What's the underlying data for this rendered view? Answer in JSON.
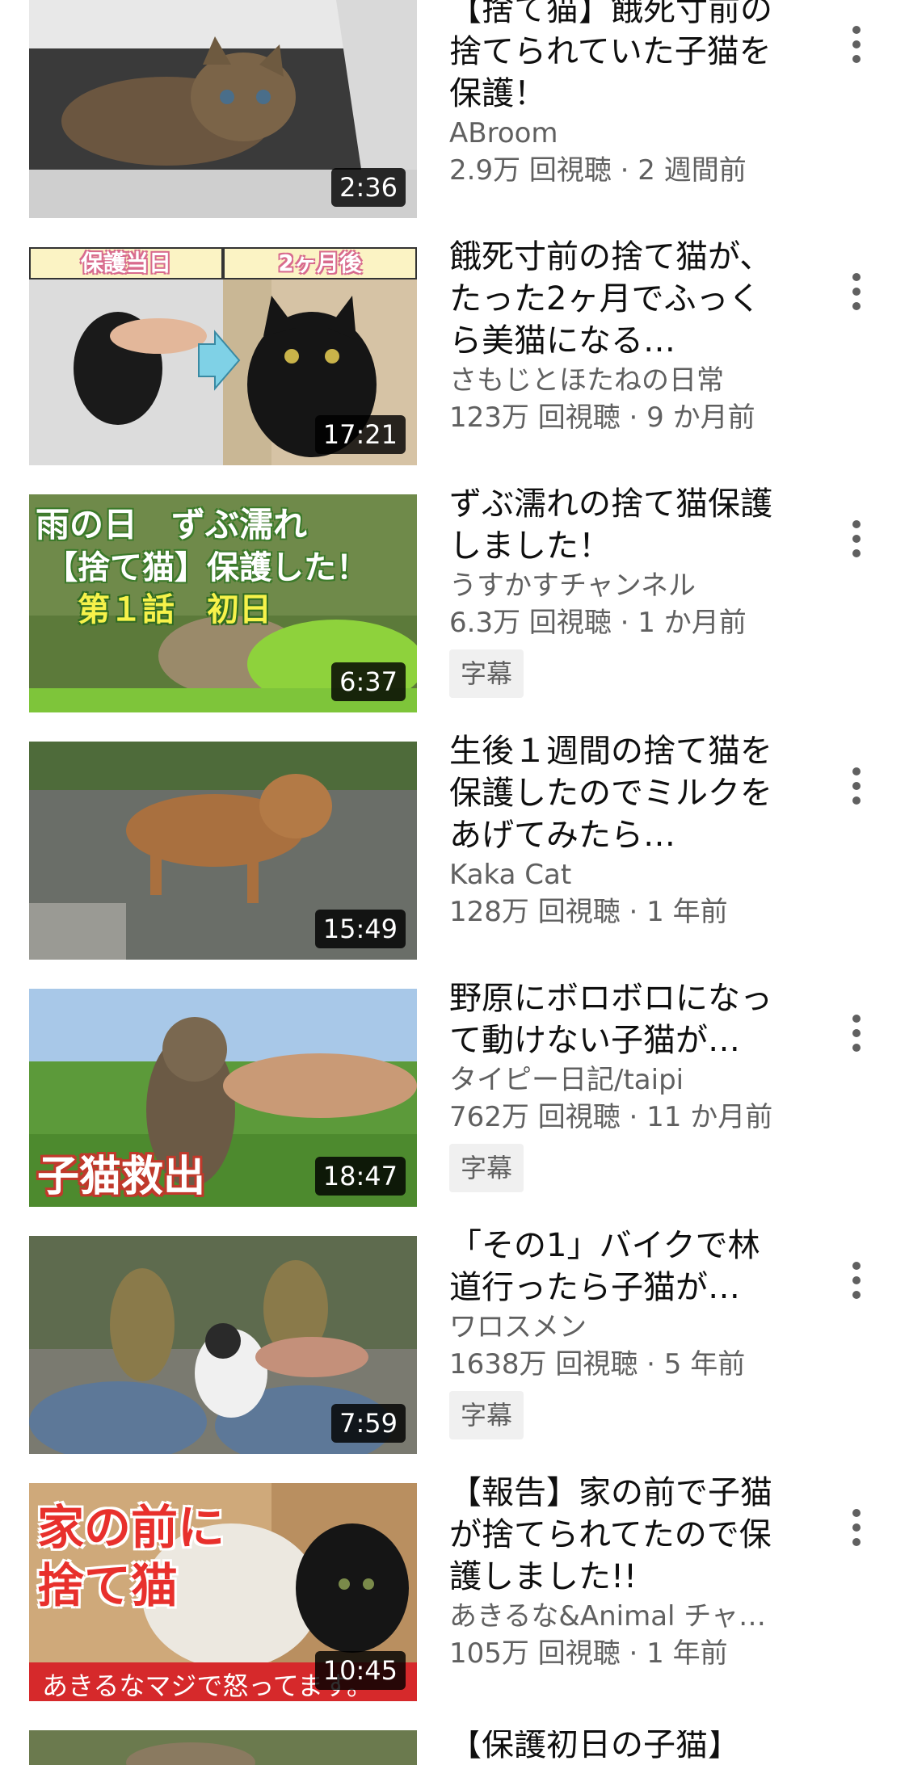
{
  "videos": [
    {
      "title": "【捨て猫】餓死寸前の捨てられていた子猫を保護！",
      "channel": "ABroom",
      "meta": "2.9万 回視聴 · 2 週間前",
      "duration": "2:36",
      "badge": ""
    },
    {
      "title": "餓死寸前の捨て猫が、たった2ヶ月でふっくら美猫になる…",
      "channel": "さもじとほたねの日常",
      "meta": "123万 回視聴 · 9 か月前",
      "duration": "17:21",
      "badge": "",
      "thumb_text": [
        "保護当日",
        "2ヶ月後"
      ]
    },
    {
      "title": "ずぶ濡れの捨て猫保護しました！",
      "channel": "うすかすチャンネル",
      "meta": "6.3万 回視聴 · 1 か月前",
      "duration": "6:37",
      "badge": "字幕",
      "thumb_text": [
        "雨の日　ずぶ濡れ",
        "【捨て猫】保護した！",
        "第１話　初日"
      ]
    },
    {
      "title": "生後１週間の捨て猫を保護したのでミルクをあげてみたら…",
      "channel": "Kaka Cat",
      "meta": "128万 回視聴 · 1 年前",
      "duration": "15:49",
      "badge": ""
    },
    {
      "title": "野原にボロボロになって動けない子猫が…",
      "channel": "タイピー日記/taipi",
      "meta": "762万 回視聴 · 11 か月前",
      "duration": "18:47",
      "badge": "字幕",
      "thumb_text": [
        "子猫救出"
      ]
    },
    {
      "title": "「その1」バイクで林道行ったら子猫が…",
      "channel": "ワロスメン",
      "meta": "1638万 回視聴 · 5 年前",
      "duration": "7:59",
      "badge": "字幕"
    },
    {
      "title": "【報告】家の前で子猫が捨てられてたので保護しました!!",
      "channel": "あきるな&Animal チャ…",
      "meta": "105万 回視聴 · 1 年前",
      "duration": "10:45",
      "badge": "",
      "thumb_text": [
        "家の前に",
        "捨て猫",
        "あきるなマジで怒ってます。"
      ]
    },
    {
      "title": "【保護初日の子猫】",
      "channel": "",
      "meta": "",
      "duration": "",
      "badge": ""
    }
  ]
}
